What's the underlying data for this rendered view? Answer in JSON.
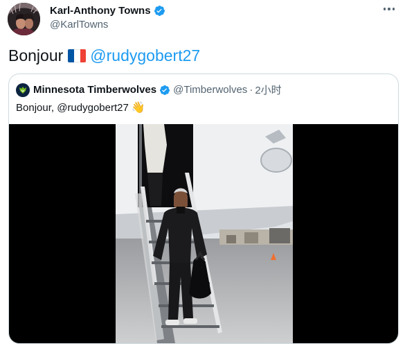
{
  "tweet": {
    "author": {
      "display_name": "Karl-Anthony Towns",
      "handle": "@KarlTowns",
      "verified": true,
      "avatar_icon": "profile-photo"
    },
    "text": "Bonjour",
    "flag_icon": "france-flag",
    "mention": "@rudygobert27",
    "more_icon": "more-horizontal-icon"
  },
  "quoted_tweet": {
    "author": {
      "display_name": "Minnesota Timberwolves",
      "handle": "@Timberwolves",
      "verified": true,
      "avatar_icon": "timberwolves-logo"
    },
    "separator": "·",
    "time": "2小时",
    "text": "Bonjour, @rudygobert27",
    "emoji": "👋",
    "media": {
      "type": "video-thumbnail",
      "icon": "player-deplaning-photo"
    }
  },
  "colors": {
    "accent": "#1d9bf0",
    "text": "#0f1419",
    "muted": "#536471",
    "border": "#cfd9de"
  }
}
